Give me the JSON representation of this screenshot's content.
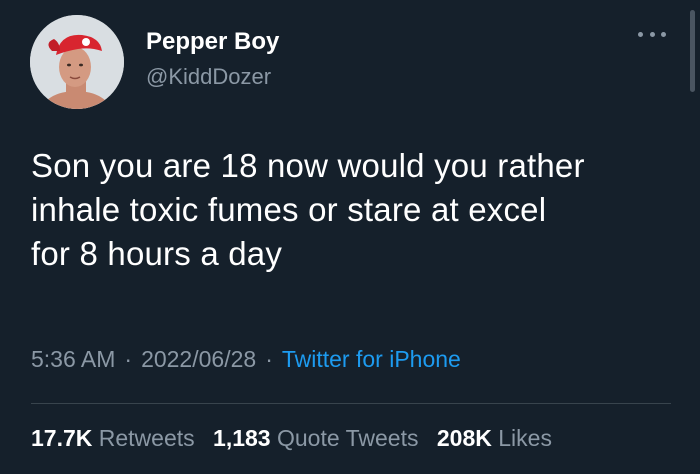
{
  "user": {
    "display_name": "Pepper Boy",
    "handle": "@KiddDozer",
    "avatar_icon": "profile-photo-red-cap"
  },
  "more_icon": "ellipsis-icon",
  "tweet": {
    "lines": [
      "Son you are 18 now would you rather",
      "inhale toxic fumes or stare at excel",
      "for 8 hours a day"
    ]
  },
  "meta": {
    "time": "5:36 AM",
    "separator": "·",
    "date": "2022/06/28",
    "source": "Twitter for iPhone"
  },
  "stats": {
    "retweets_count": "17.7K",
    "retweets_label": "Retweets",
    "quotes_count": "1,183",
    "quotes_label": "Quote Tweets",
    "likes_count": "208K",
    "likes_label": "Likes"
  },
  "colors": {
    "background": "#15202b",
    "text": "#ffffff",
    "secondary_text": "#8b98a5",
    "link": "#1d9bf0",
    "divider": "#38444d"
  }
}
